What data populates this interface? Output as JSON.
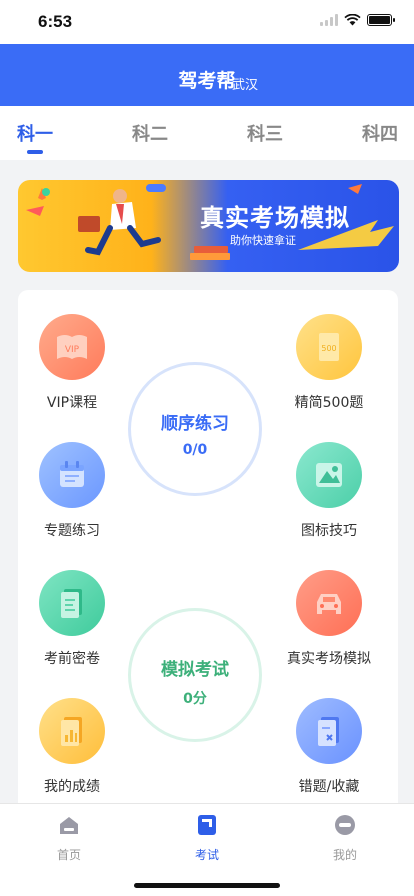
{
  "status": {
    "time": "6:53"
  },
  "header": {
    "title": "驾考帮",
    "city": "武汉"
  },
  "subject_tabs": [
    {
      "label": "科一",
      "active": true
    },
    {
      "label": "科二",
      "active": false
    },
    {
      "label": "科三",
      "active": false
    },
    {
      "label": "科四",
      "active": false
    }
  ],
  "banner": {
    "title": "真实考场模拟",
    "subtitle": "助你快速拿证"
  },
  "features": {
    "vip": "VIP课程",
    "jingjian": "精简500题",
    "zhuanti": "专题练习",
    "tubiao": "图标技巧",
    "kaoqian": "考前密卷",
    "zhenshi": "真实考场模拟",
    "chengji": "我的成绩",
    "cuoti": "错题/收藏"
  },
  "order_practice": {
    "title": "顺序练习",
    "value": "0/0"
  },
  "mock_exam": {
    "title": "模拟考试",
    "value": "0分"
  },
  "tabbar": [
    {
      "label": "首页",
      "icon": "home-icon",
      "active": false
    },
    {
      "label": "考试",
      "icon": "exam-icon",
      "active": true
    },
    {
      "label": "我的",
      "icon": "profile-icon",
      "active": false
    }
  ],
  "colors": {
    "primary": "#3a6cf6",
    "accent_green": "#3db07a"
  }
}
